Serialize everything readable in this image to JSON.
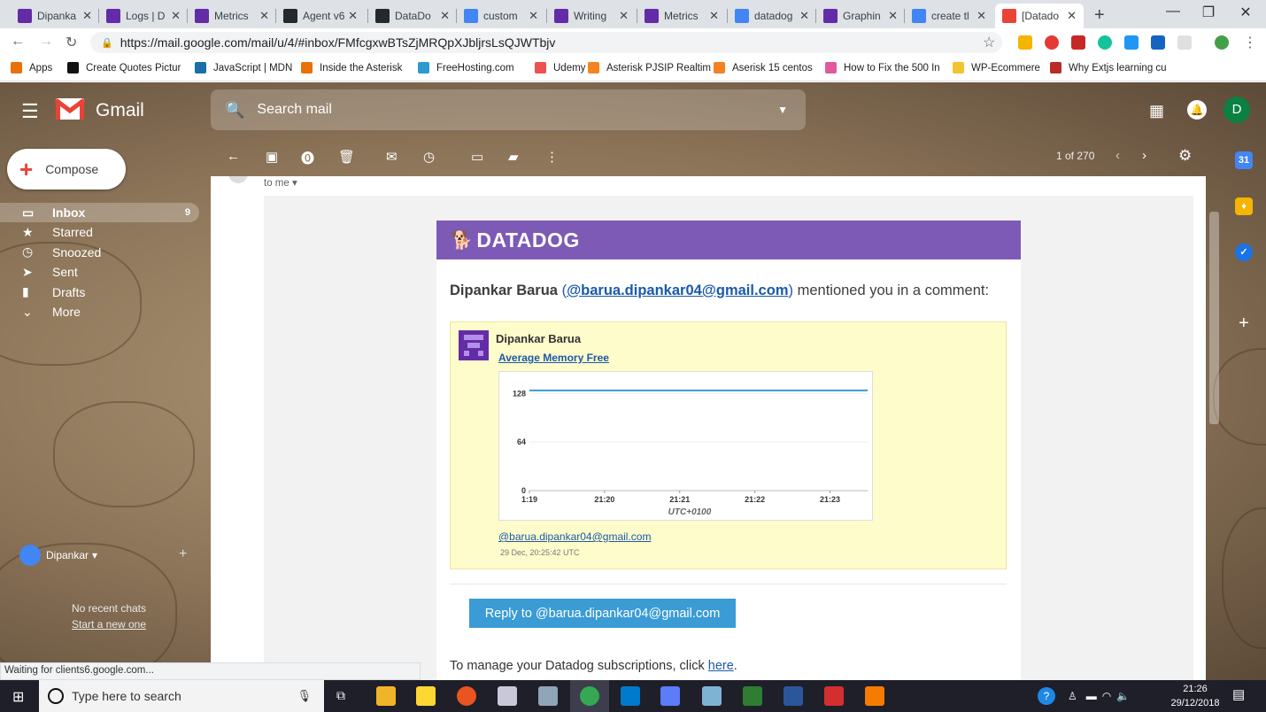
{
  "browser": {
    "tabs": [
      {
        "title": "Dipanka",
        "favicon": "datadog-icon",
        "color": "#632ca6"
      },
      {
        "title": "Logs | D",
        "favicon": "datadog-icon",
        "color": "#632ca6"
      },
      {
        "title": "Metrics",
        "favicon": "datadog-icon",
        "color": "#632ca6"
      },
      {
        "title": "Agent v6",
        "favicon": "github-icon",
        "color": "#24292e"
      },
      {
        "title": "DataDo",
        "favicon": "github-icon",
        "color": "#24292e"
      },
      {
        "title": "custom",
        "favicon": "google-icon",
        "color": "#4285f4"
      },
      {
        "title": "Writing",
        "favicon": "datadog-icon",
        "color": "#632ca6"
      },
      {
        "title": "Metrics",
        "favicon": "datadog-icon",
        "color": "#632ca6"
      },
      {
        "title": "datadog",
        "favicon": "google-icon",
        "color": "#4285f4"
      },
      {
        "title": "Graphin",
        "favicon": "datadog-icon",
        "color": "#632ca6"
      },
      {
        "title": "create tl",
        "favicon": "google-icon",
        "color": "#4285f4"
      },
      {
        "title": "[Datado",
        "favicon": "gmail-icon",
        "color": "#ea4335"
      }
    ],
    "url": "https://mail.google.com/mail/u/4/#inbox/FMfcgxwBTsZjMRQpXJbljrsLsQJWTbjv",
    "bookmarks": [
      {
        "label": "Apps",
        "icon": "apps-grid-icon",
        "color": "#e8710a"
      },
      {
        "label": "Create Quotes Pictur",
        "icon": "bookmark-icon",
        "color": "#111111"
      },
      {
        "label": "JavaScript | MDN",
        "icon": "mdn-icon",
        "color": "#1b6ea8"
      },
      {
        "label": "Inside the Asterisk",
        "icon": "asterisk-icon",
        "color": "#e8710a"
      },
      {
        "label": "FreeHosting.com",
        "icon": "globe-icon",
        "color": "#2e9ad0"
      },
      {
        "label": "Udemy",
        "icon": "udemy-icon",
        "color": "#ec5252"
      },
      {
        "label": "Asterisk PJSIP Realtim",
        "icon": "asterisk-a-icon",
        "color": "#f58220"
      },
      {
        "label": "Aserisk 15 centos",
        "icon": "asterisk-a-icon",
        "color": "#f58220"
      },
      {
        "label": "How to Fix the 500 In",
        "icon": "star-icon",
        "color": "#e05a9c"
      },
      {
        "label": "WP-Ecommere",
        "icon": "folder-icon",
        "color": "#f4c430"
      },
      {
        "label": "Why Extjs learning cu",
        "icon": "quora-icon",
        "color": "#b92b27"
      }
    ],
    "status": "Waiting for clients6.google.com..."
  },
  "gmail": {
    "product": "Gmail",
    "search_placeholder": "Search mail",
    "avatar_letter": "D",
    "compose_label": "Compose",
    "nav": [
      {
        "label": "Inbox",
        "icon": "inbox-icon",
        "count": "9"
      },
      {
        "label": "Starred",
        "icon": "star-icon",
        "count": ""
      },
      {
        "label": "Snoozed",
        "icon": "clock-icon",
        "count": ""
      },
      {
        "label": "Sent",
        "icon": "send-icon",
        "count": ""
      },
      {
        "label": "Drafts",
        "icon": "draft-icon",
        "count": ""
      },
      {
        "label": "More",
        "icon": "chevron-down-icon",
        "count": ""
      }
    ],
    "hangouts_user": "Dipankar",
    "no_chats": "No recent chats",
    "start_new": "Start a new one",
    "pager": "1 of 270",
    "to_me": "to me"
  },
  "email": {
    "brand": "DATADOG",
    "sender_name": "Dipankar Barua",
    "sender_email": "@barua.dipankar04@gmail.com",
    "mention_suffix": "mentioned you in a comment:",
    "comment_author": "Dipankar Barua",
    "graph_title": "Average Memory Free",
    "comment_email": "@barua.dipankar04@gmail.com",
    "comment_date": "29 Dec, 20:25:42 UTC",
    "reply_button": "Reply to @barua.dipankar04@gmail.com",
    "manage_text": "To manage your Datadog subscriptions, click",
    "manage_link": "here",
    "accent_purple": "#7d5ab5",
    "button_blue": "#3a9bd5"
  },
  "chart_data": {
    "type": "line",
    "x": [
      "1:19",
      "21:20",
      "21:21",
      "21:22",
      "21:23"
    ],
    "x_label_first": "1:19",
    "xlabel": "UTC+0100",
    "yticks": [
      0,
      64,
      128
    ],
    "ylim": [
      0,
      140
    ],
    "series": [
      {
        "values": [
          132,
          132,
          132,
          132,
          132,
          132
        ],
        "color": "#3a9bd5"
      }
    ],
    "grid": true
  },
  "taskbar": {
    "search_placeholder": "Type here to search",
    "time": "21:26",
    "date": "29/12/2018"
  }
}
